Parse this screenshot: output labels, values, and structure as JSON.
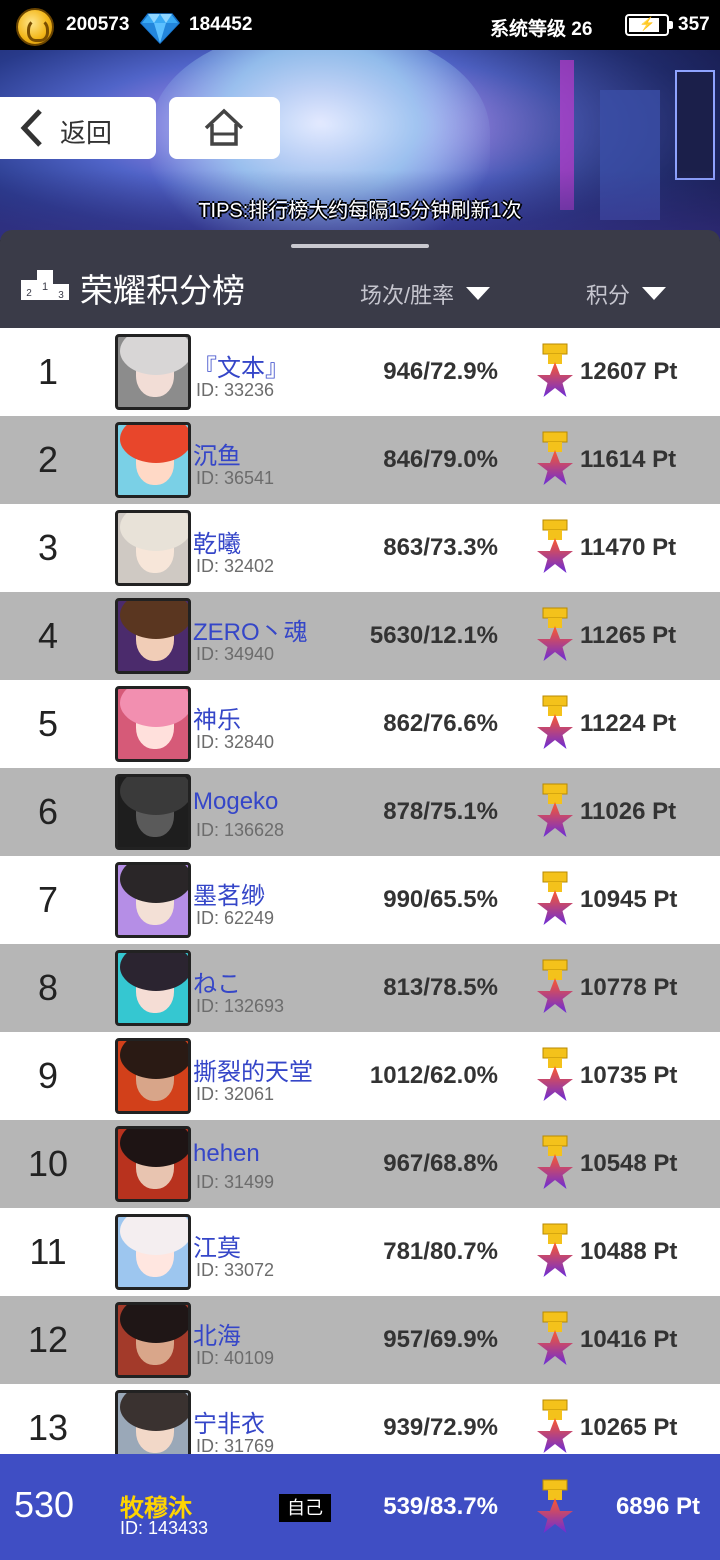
{
  "status": {
    "coins": "200573",
    "gems": "184452",
    "level_text": "系统等级 26",
    "battery": "357"
  },
  "nav": {
    "back_label": "返回",
    "tips": "TIPS:排行榜大约每隔15分钟刷新1次"
  },
  "board": {
    "title": "荣耀积分榜",
    "col_rate": "场次/胜率",
    "col_score": "积分"
  },
  "rows": [
    {
      "rank": "1",
      "name": "『文本』",
      "id": "ID: 33236",
      "rate": "946/72.9%",
      "score": "12607 Pt",
      "hair": "#d8d6d6",
      "face": "#f2ddd6",
      "bg": "#8c8c8c"
    },
    {
      "rank": "2",
      "name": "沉鱼",
      "id": "ID: 36541",
      "rate": "846/79.0%",
      "score": "11614 Pt",
      "hair": "#e8462b",
      "face": "#ffd9c6",
      "bg": "#7ad0e6"
    },
    {
      "rank": "3",
      "name": "乾曦",
      "id": "ID: 32402",
      "rate": "863/73.3%",
      "score": "11470 Pt",
      "hair": "#e8e2d8",
      "face": "#f7e6d9",
      "bg": "#cfc9c3"
    },
    {
      "rank": "4",
      "name": "ZERO丶魂",
      "id": "ID: 34940",
      "rate": "5630/12.1%",
      "score": "11265 Pt",
      "hair": "#5a3620",
      "face": "#f1cdb7",
      "bg": "#4b2b6c"
    },
    {
      "rank": "5",
      "name": "神乐",
      "id": "ID: 32840",
      "rate": "862/76.6%",
      "score": "11224 Pt",
      "hair": "#f28fb0",
      "face": "#ffe0dc",
      "bg": "#d65a78"
    },
    {
      "rank": "6",
      "name": "Mogeko",
      "id": "ID: 136628",
      "rate": "878/75.1%",
      "score": "11026 Pt",
      "hair": "#3a3a3a",
      "face": "#5a5a5a",
      "bg": "#1e1e1e"
    },
    {
      "rank": "7",
      "name": "墨茗缈",
      "id": "ID: 62249",
      "rate": "990/65.5%",
      "score": "10945 Pt",
      "hair": "#2a2628",
      "face": "#f3e0d6",
      "bg": "#b58ee6"
    },
    {
      "rank": "8",
      "name": "ねこ",
      "id": "ID: 132693",
      "rate": "813/78.5%",
      "score": "10778 Pt",
      "hair": "#2b2430",
      "face": "#f5ddd5",
      "bg": "#35c7d1"
    },
    {
      "rank": "9",
      "name": "撕裂的天堂",
      "id": "ID: 32061",
      "rate": "1012/62.0%",
      "score": "10735 Pt",
      "hair": "#2a1a14",
      "face": "#d8a589",
      "bg": "#d2401a"
    },
    {
      "rank": "10",
      "name": "hehen",
      "id": "ID: 31499",
      "rate": "967/68.8%",
      "score": "10548 Pt",
      "hair": "#1e1414",
      "face": "#e8c4b0",
      "bg": "#b8321e"
    },
    {
      "rank": "11",
      "name": "江莫",
      "id": "ID: 33072",
      "rate": "781/80.7%",
      "score": "10488 Pt",
      "hair": "#f4eef0",
      "face": "#ffe6e0",
      "bg": "#9dc6ef"
    },
    {
      "rank": "12",
      "name": "北海",
      "id": "ID: 40109",
      "rate": "957/69.9%",
      "score": "10416 Pt",
      "hair": "#1f1616",
      "face": "#d9a68a",
      "bg": "#a33a2a"
    },
    {
      "rank": "13",
      "name": "宁非衣",
      "id": "ID: 31769",
      "rate": "939/72.9%",
      "score": "10265 Pt",
      "hair": "#3a3230",
      "face": "#f2d8c8",
      "bg": "#9aa8b8"
    }
  ],
  "self": {
    "rank": "530",
    "name": "牧穆沐",
    "id": "ID: 143433",
    "tag": "自己",
    "rate": "539/83.7%",
    "score": "6896 Pt"
  },
  "colors": {
    "accent_blue": "#3f4ec4",
    "name_blue": "#3546c8",
    "row_alt": "#b6b6b6",
    "self_name": "#ffd400"
  }
}
